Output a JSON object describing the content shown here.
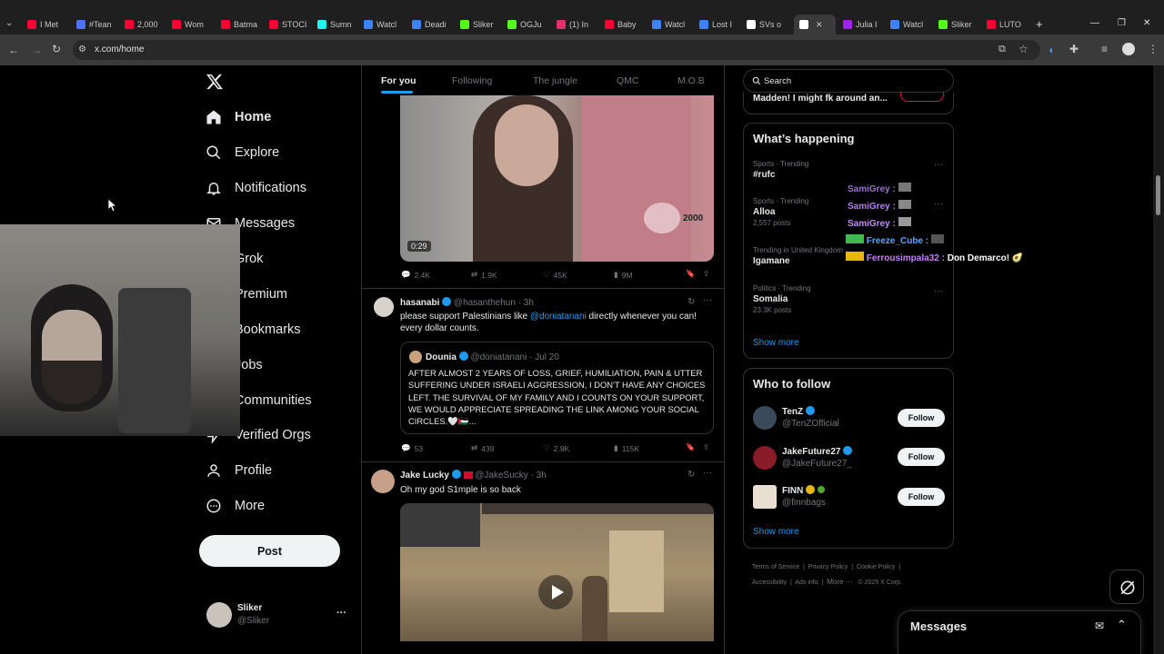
{
  "browser": {
    "tabs": [
      {
        "label": "I Met",
        "color": "#ff0033"
      },
      {
        "label": "#Tean",
        "color": "#4a73ff"
      },
      {
        "label": "2,000",
        "color": "#ff0033"
      },
      {
        "label": "Wom",
        "color": "#ff0033"
      },
      {
        "label": "Batma",
        "color": "#ff0033"
      },
      {
        "label": "STOCI",
        "color": "#ff0033"
      },
      {
        "label": "Sumn",
        "color": "#25f4ee"
      },
      {
        "label": "Watcl",
        "color": "#3b82f6"
      },
      {
        "label": "Deadi",
        "color": "#3b82f6"
      },
      {
        "label": "Sliker",
        "color": "#53fc18"
      },
      {
        "label": "OGJu",
        "color": "#53fc18"
      },
      {
        "label": "(1) In",
        "color": "#e1306c"
      },
      {
        "label": "Baby",
        "color": "#ff0033"
      },
      {
        "label": "Watcl",
        "color": "#3b82f6"
      },
      {
        "label": "Lost I",
        "color": "#3b82f6"
      },
      {
        "label": "SVs o",
        "color": "#ffffff"
      },
      {
        "label": "",
        "color": "#ffffff"
      },
      {
        "label": "Julia I",
        "color": "#a020f0"
      },
      {
        "label": "Watcl",
        "color": "#3b82f6"
      },
      {
        "label": "Sliker",
        "color": "#53fc18"
      },
      {
        "label": "LUTO",
        "color": "#ff0033"
      }
    ],
    "url": "x.com/home",
    "new_tab": "+",
    "minimize": "—",
    "restore": "❐",
    "close": "✕"
  },
  "nav": {
    "logo": "X",
    "items": [
      {
        "label": "Home",
        "icon": "home-icon"
      },
      {
        "label": "Explore",
        "icon": "search-icon"
      },
      {
        "label": "Notifications",
        "icon": "bell-icon"
      },
      {
        "label": "Messages",
        "icon": "envelope-icon"
      },
      {
        "label": "Grok",
        "icon": "grok-icon"
      },
      {
        "label": "Premium",
        "icon": "x-premium-icon"
      },
      {
        "label": "Bookmarks",
        "icon": "bookmark-icon"
      },
      {
        "label": "Jobs",
        "icon": "briefcase-icon"
      },
      {
        "label": "Communities",
        "icon": "people-icon"
      },
      {
        "label": "Verified Orgs",
        "icon": "lightning-icon"
      },
      {
        "label": "Profile",
        "icon": "person-icon"
      },
      {
        "label": "More",
        "icon": "more-circle-icon"
      }
    ],
    "post_button": "Post",
    "account": {
      "name": "Sliker",
      "handle": "@Sliker",
      "menu": "···"
    }
  },
  "feed": {
    "tabs": [
      "For you",
      "Following",
      "The jungle",
      "QMC",
      "M.O.B"
    ],
    "posts": [
      {
        "video_duration": "0:29",
        "video_badge": "2000",
        "stats": {
          "replies": "2.4K",
          "reposts": "1.9K",
          "likes": "45K",
          "views": "9M"
        }
      },
      {
        "name": "hasanabi",
        "handle": "@hasanthehun",
        "time": "· 3h",
        "text_before": "please support Palestinians like ",
        "mention": "@doniatanani",
        "text_after": " directly whenever you can! every dollar counts.",
        "quote": {
          "name": "Dounia",
          "handle": "@doniatanani",
          "time": "· Jul 20",
          "text": "AFTER ALMOST 2 YEARS OF LOSS, GRIEF, HUMILIATION, PAIN & UTTER SUFFERING UNDER ISRAELI AGGRESSION, I DON'T HAVE ANY CHOICES LEFT. THE SURVIVAL OF MY FAMILY AND I COUNTS ON YOUR SUPPORT, WE WOULD APPRECIATE SPREADING THE LINK AMONG YOUR SOCIAL CIRCLES.🤍🇵🇸..."
        },
        "stats": {
          "replies": "53",
          "reposts": "439",
          "likes": "2.9K",
          "views": "115K"
        }
      },
      {
        "name": "Jake Lucky",
        "handle": "@JakeSucky",
        "time": "· 3h",
        "text": "Oh my god S1mple is so back"
      }
    ]
  },
  "right": {
    "search_placeholder": "Search",
    "top_snippet": "Madden! I might fk around an...",
    "whats_happening": {
      "title": "What’s happening",
      "trends": [
        {
          "context": "Sports · Trending",
          "name": "#rufc",
          "posts": ""
        },
        {
          "context": "Sports · Trending",
          "name": "Alloa",
          "posts": "2,557 posts"
        },
        {
          "context": "Trending in United Kingdom",
          "name": "Igamane",
          "posts": ""
        },
        {
          "context": "Politics · Trending",
          "name": "Somalia",
          "posts": "23.3K posts"
        }
      ],
      "show_more": "Show more"
    },
    "who_to_follow": {
      "title": "Who to follow",
      "accounts": [
        {
          "name": "TenZ",
          "handle": "@TenZOfficial",
          "button": "Follow"
        },
        {
          "name": "JakeFuture27",
          "handle": "@JakeFuture27_",
          "button": "Follow"
        },
        {
          "name": "FINN",
          "handle": "@finnbags",
          "button": "Follow"
        }
      ],
      "show_more": "Show more"
    },
    "footer": [
      "Terms of Service",
      "Privacy Policy",
      "Cookie Policy",
      "Accessibility",
      "Ads info",
      "More ···",
      "© 2025 X Corp."
    ]
  },
  "chat_overlay": [
    {
      "user": "SamiGrey :",
      "message": "",
      "color": "#9b6fd1"
    },
    {
      "user": "SamiGrey :",
      "message": "",
      "color": "#b57cf0"
    },
    {
      "user": "SamiGrey :",
      "message": "",
      "color": "#c48cff"
    },
    {
      "user": "Freeze_Cube :",
      "message": "",
      "color": "#58a6ff"
    },
    {
      "user": "Ferrousimpala32 :",
      "message": "Don Demarco! 🥑",
      "color": "#c77dff"
    }
  ],
  "messages_drawer": {
    "title": "Messages"
  }
}
